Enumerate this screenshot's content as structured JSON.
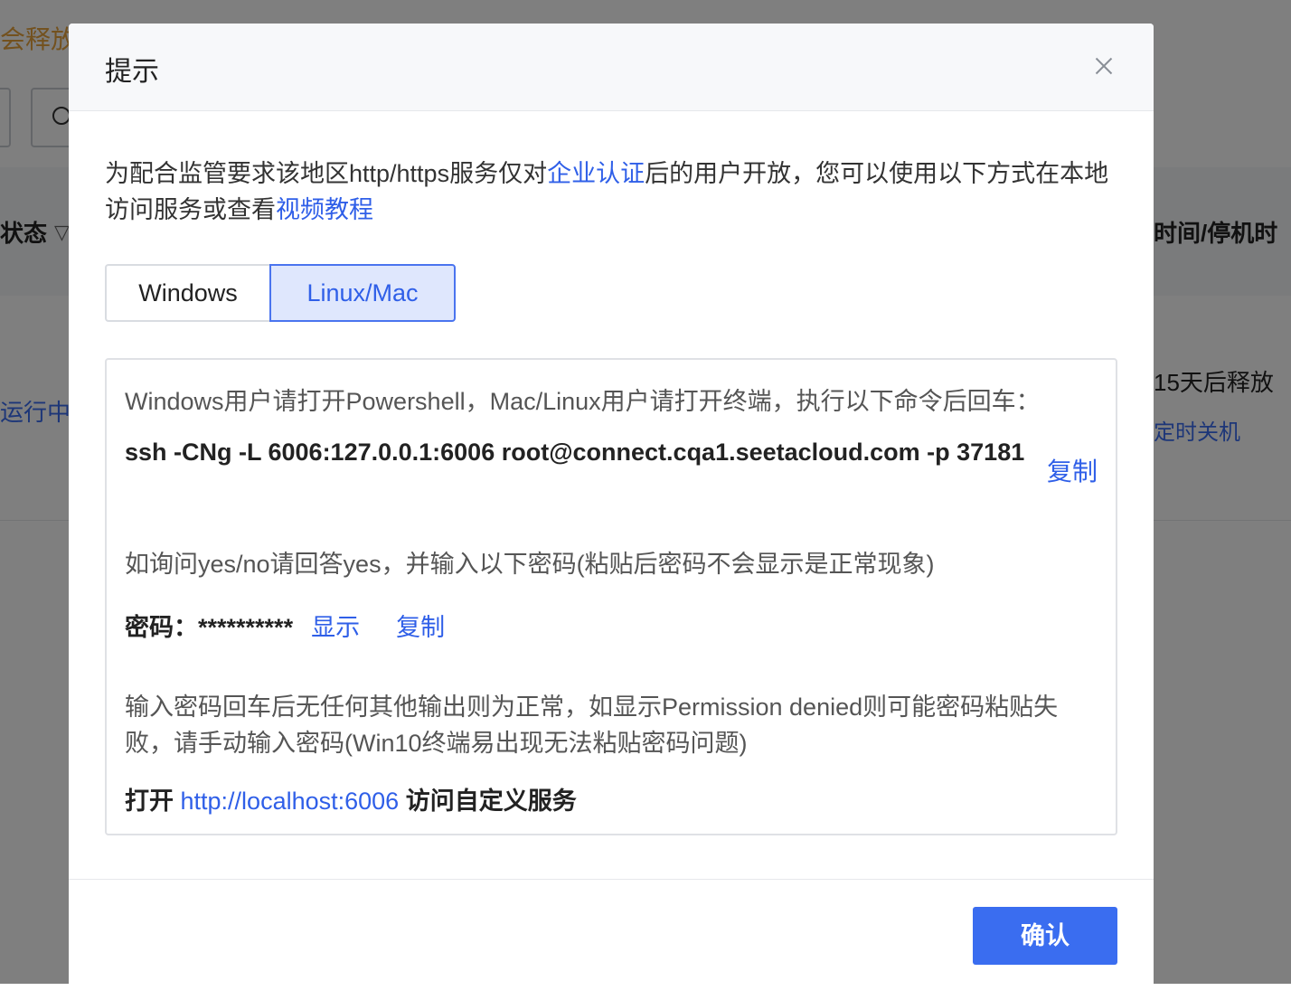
{
  "background": {
    "warning_text": "会释放",
    "status_header": "状态",
    "time_header": "时间/停机时",
    "running_text": "运行中",
    "release_text": "15天后释放",
    "shutdown_link": "定时关机"
  },
  "modal": {
    "title": "提示",
    "intro": {
      "part1": "为配合监管要求该地区http/https服务仅对",
      "link1": "企业认证",
      "part2": "后的用户开放，您可以使用以下方式在本地访问服务或查看",
      "link2": "视频教程"
    },
    "tabs": [
      {
        "label": "Windows",
        "active": false
      },
      {
        "label": "Linux/Mac",
        "active": true
      }
    ],
    "panel": {
      "instruction": "Windows用户请打开Powershell，Mac/Linux用户请打开终端，执行以下命令后回车：",
      "command": "ssh -CNg -L 6006:127.0.0.1:6006 root@connect.cqa1.seetacloud.com -p 37181",
      "copy_label": "复制",
      "yesno_hint": "如询问yes/no请回答yes，并输入以下密码(粘贴后密码不会显示是正常现象)",
      "password_label": "密码：",
      "password_value": "**********",
      "show_label": "显示",
      "password_copy_label": "复制",
      "note": "输入密码回车后无任何其他输出则为正常，如显示Permission denied则可能密码粘贴失 败，请手动输入密码(Win10终端易出现无法粘贴密码问题)",
      "open_prefix": "打开",
      "open_url": "http://localhost:6006",
      "open_suffix": "访问自定义服务"
    },
    "confirm_label": "确认"
  },
  "colors": {
    "accent": "#3a6df0",
    "link": "#2f5fe8",
    "tab_active_bg": "#dfe7fd",
    "warning": "#e6a23c"
  }
}
